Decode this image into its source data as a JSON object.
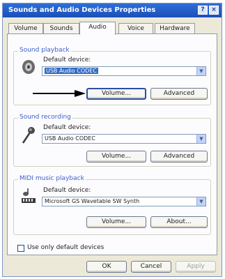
{
  "window": {
    "title": "Sounds and Audio Devices Properties",
    "help_glyph": "?",
    "close_glyph": "×"
  },
  "tabs": [
    {
      "label": "Volume"
    },
    {
      "label": "Sounds"
    },
    {
      "label": "Audio"
    },
    {
      "label": "Voice"
    },
    {
      "label": "Hardware"
    }
  ],
  "active_tab": "Audio",
  "sound_playback": {
    "legend": "Sound playback",
    "default_label": "Default device:",
    "device": "USB Audio CODEC",
    "volume_button": "Volume...",
    "advanced_button": "Advanced"
  },
  "sound_recording": {
    "legend": "Sound recording",
    "default_label": "Default device:",
    "device": "USB Audio CODEC",
    "volume_button": "Volume...",
    "advanced_button": "Advanced"
  },
  "midi_playback": {
    "legend": "MIDI music playback",
    "default_label": "Default device:",
    "device": "Microsoft GS Wavetable SW Synth",
    "volume_button": "Volume...",
    "about_button": "About..."
  },
  "use_only_default": {
    "label": "Use only default devices",
    "checked": false
  },
  "footer": {
    "ok_button": "OK",
    "cancel_button": "Cancel",
    "apply_button": "Apply"
  },
  "colors": {
    "titlebar": "#1a4fb8",
    "legend_text": "#3a5ec8",
    "selection": "#316ac5"
  }
}
